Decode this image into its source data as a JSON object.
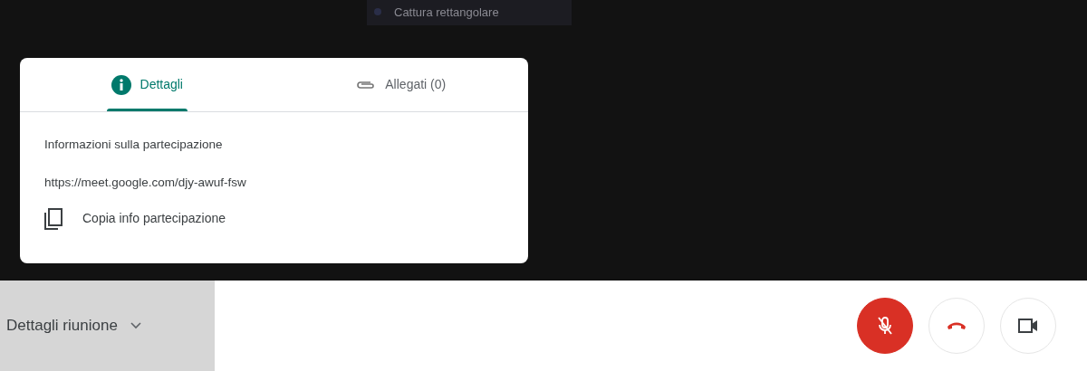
{
  "tooltip": {
    "label": "Cattura rettangolare"
  },
  "panel": {
    "tabs": [
      {
        "label": "Dettagli",
        "kind": "info",
        "selected": true
      },
      {
        "label": "Allegati (0)",
        "kind": "attachment",
        "selected": false
      }
    ],
    "heading": "Informazioni sulla partecipazione",
    "link": "https://meet.google.com/djy-awuf-fsw",
    "copy_action": "Copia info partecipazione"
  },
  "meeting_details": {
    "label": "Dettagli riunione",
    "expanded": false
  },
  "controls": [
    {
      "kind": "mic",
      "muted": true
    },
    {
      "kind": "hangup"
    },
    {
      "kind": "camera",
      "muted": false
    }
  ]
}
